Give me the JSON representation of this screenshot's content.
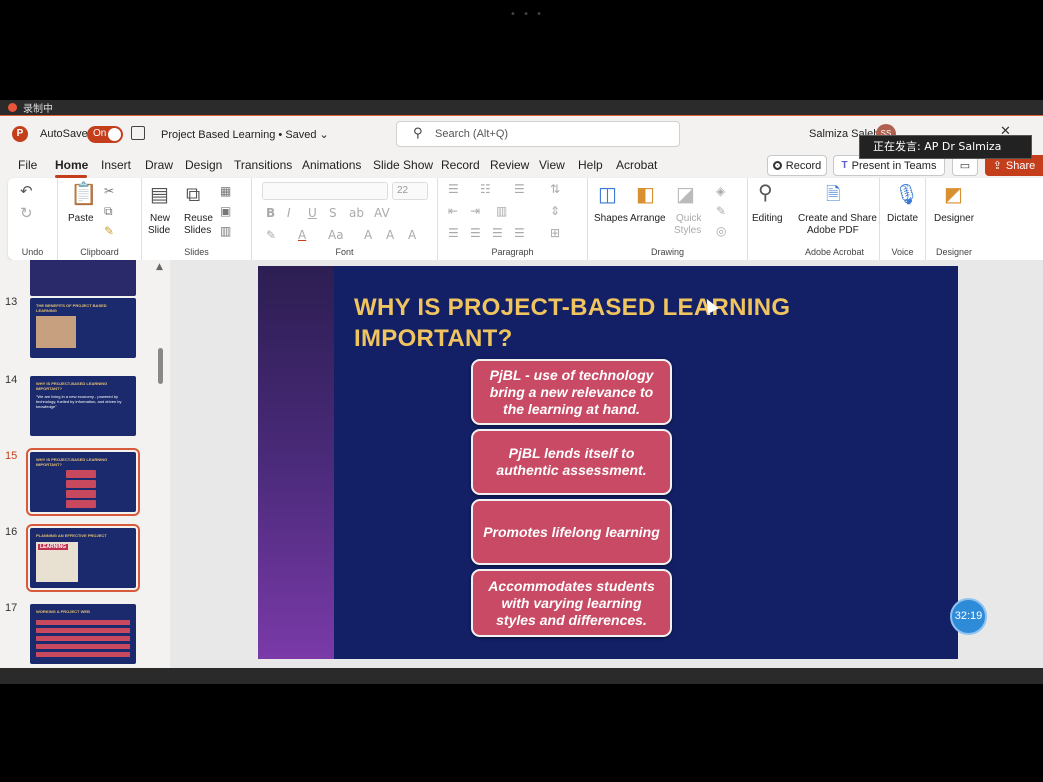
{
  "recording": {
    "label": "录制中",
    "top_dots": "• • •"
  },
  "titlebar": {
    "autosave_label": "AutoSave",
    "autosave_state": "On",
    "doc_title": "Project Based Learning • Saved ⌄",
    "search_placeholder": "Search (Alt+Q)",
    "user_name": "Salmiza Saleh",
    "avatar_initials": "SS"
  },
  "speaker": {
    "label": "正在发言: AP Dr Salmiza"
  },
  "menu": {
    "tabs": [
      "File",
      "Home",
      "Insert",
      "Draw",
      "Design",
      "Transitions",
      "Animations",
      "Slide Show",
      "Record",
      "Review",
      "View",
      "Help",
      "Acrobat"
    ],
    "active": "Home",
    "record_button": "Record",
    "present_button": "Present in Teams",
    "share_button": "Share"
  },
  "ribbon": {
    "undo_group": "Undo",
    "clipboard": {
      "paste": "Paste",
      "group": "Clipboard"
    },
    "slides": {
      "new_slide_1": "New",
      "new_slide_2": "Slide",
      "reuse_1": "Reuse",
      "reuse_2": "Slides",
      "group": "Slides"
    },
    "font": {
      "size": "22",
      "group": "Font"
    },
    "paragraph": {
      "group": "Paragraph"
    },
    "drawing": {
      "shapes": "Shapes",
      "arrange": "Arrange",
      "quick_styles_1": "Quick",
      "quick_styles_2": "Styles",
      "group": "Drawing"
    },
    "editing": {
      "label": "Editing"
    },
    "acrobat": {
      "label_1": "Create and Share",
      "label_2": "Adobe PDF",
      "group": "Adobe Acrobat"
    },
    "voice": {
      "dictate": "Dictate",
      "group": "Voice"
    },
    "designer": {
      "label": "Designer",
      "group": "Designer"
    }
  },
  "thumbnails": [
    {
      "number": "13",
      "title": "THE BENEFITS OF PROJECT BASED LEARNING"
    },
    {
      "number": "14",
      "title": "WHY IS PROJECT-BASED LEARNING IMPORTANT?",
      "body": "\"We are living in a new economy - powered by technology, fuelled by information, and driven by knowledge\""
    },
    {
      "number": "15",
      "title": "WHY IS PROJECT-BASED LEARNING IMPORTANT?"
    },
    {
      "number": "16",
      "title": "PLANNING AN EFFECTIVE PROJECT",
      "badge": "LEARNING"
    },
    {
      "number": "17",
      "title": "WORKING A PROJECT WEB"
    }
  ],
  "slide": {
    "title": "WHY IS PROJECT-BASED LEARNING IMPORTANT?",
    "points": [
      "PjBL - use of technology bring a new relevance to the learning at hand.",
      "PjBL lends itself to authentic assessment.",
      "Promotes lifelong learning",
      "Accommodates students with varying learning styles and differences."
    ],
    "title_color": "#f0c45e",
    "box_color": "#c84a64",
    "background_color": "#132066"
  },
  "timer": {
    "value": "32:19"
  }
}
